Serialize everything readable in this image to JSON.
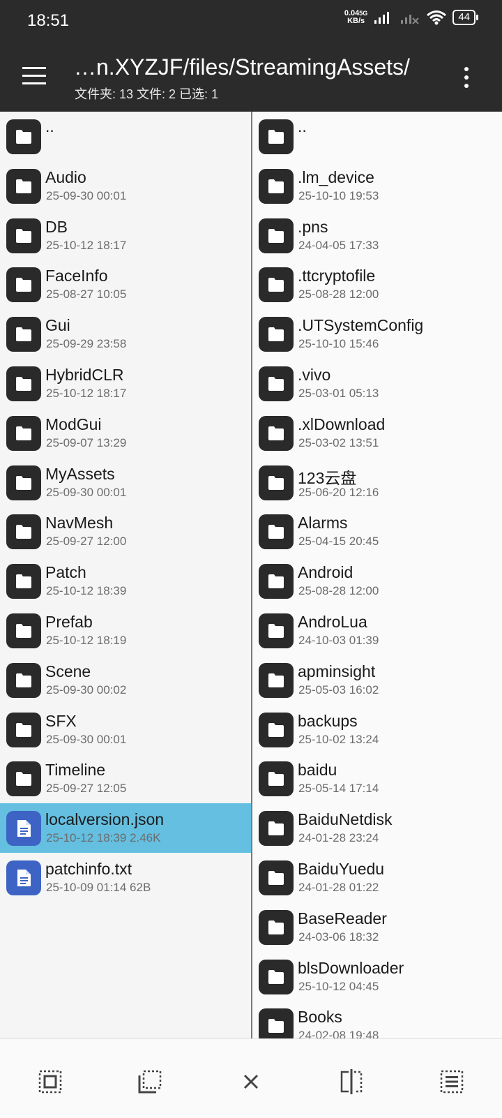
{
  "status": {
    "time": "18:51",
    "speed_value": "0.04",
    "speed_unit": "KB/s",
    "network": "5G",
    "battery": "44"
  },
  "header": {
    "path": "…n.XYZJF/files/StreamingAssets/",
    "counts": "文件夹: 13   文件: 2   已选: 1"
  },
  "left_pane": {
    "items": [
      {
        "name": "..",
        "meta": "",
        "type": "folder"
      },
      {
        "name": "Audio",
        "meta": "25-09-30 00:01",
        "type": "folder"
      },
      {
        "name": "DB",
        "meta": "25-10-12 18:17",
        "type": "folder"
      },
      {
        "name": "FaceInfo",
        "meta": "25-08-27 10:05",
        "type": "folder"
      },
      {
        "name": "Gui",
        "meta": "25-09-29 23:58",
        "type": "folder"
      },
      {
        "name": "HybridCLR",
        "meta": "25-10-12 18:17",
        "type": "folder"
      },
      {
        "name": "ModGui",
        "meta": "25-09-07 13:29",
        "type": "folder"
      },
      {
        "name": "MyAssets",
        "meta": "25-09-30 00:01",
        "type": "folder"
      },
      {
        "name": "NavMesh",
        "meta": "25-09-27 12:00",
        "type": "folder"
      },
      {
        "name": "Patch",
        "meta": "25-10-12 18:39",
        "type": "folder"
      },
      {
        "name": "Prefab",
        "meta": "25-10-12 18:19",
        "type": "folder"
      },
      {
        "name": "Scene",
        "meta": "25-09-30 00:02",
        "type": "folder"
      },
      {
        "name": "SFX",
        "meta": "25-09-30 00:01",
        "type": "folder"
      },
      {
        "name": "Timeline",
        "meta": "25-09-27 12:05",
        "type": "folder"
      },
      {
        "name": "localversion.json",
        "meta": "25-10-12 18:39  2.46K",
        "type": "file",
        "selected": true
      },
      {
        "name": "patchinfo.txt",
        "meta": "25-10-09 01:14  62B",
        "type": "file"
      }
    ]
  },
  "right_pane": {
    "items": [
      {
        "name": "..",
        "meta": ""
      },
      {
        "name": ".lm_device",
        "meta": "25-10-10 19:53"
      },
      {
        "name": ".pns",
        "meta": "24-04-05 17:33"
      },
      {
        "name": ".ttcryptofile",
        "meta": "25-08-28 12:00"
      },
      {
        "name": ".UTSystemConfig",
        "meta": "25-10-10 15:46"
      },
      {
        "name": ".vivo",
        "meta": "25-03-01 05:13"
      },
      {
        "name": ".xlDownload",
        "meta": "25-03-02 13:51"
      },
      {
        "name": "123云盘",
        "meta": "25-06-20 12:16"
      },
      {
        "name": "Alarms",
        "meta": "25-04-15 20:45"
      },
      {
        "name": "Android",
        "meta": "25-08-28 12:00"
      },
      {
        "name": "AndroLua",
        "meta": "24-10-03 01:39"
      },
      {
        "name": "apminsight",
        "meta": "25-05-03 16:02"
      },
      {
        "name": "backups",
        "meta": "25-10-02 13:24"
      },
      {
        "name": "baidu",
        "meta": "25-05-14 17:14"
      },
      {
        "name": "BaiduNetdisk",
        "meta": "24-01-28 23:24"
      },
      {
        "name": "BaiduYuedu",
        "meta": "24-01-28 01:22"
      },
      {
        "name": "BaseReader",
        "meta": "24-03-06 18:32"
      },
      {
        "name": "blsDownloader",
        "meta": "25-10-12 04:45"
      },
      {
        "name": "Books",
        "meta": "24-02-08 19:48"
      }
    ]
  },
  "bottom_bar": {
    "icons": [
      "select-all-icon",
      "select-range-icon",
      "close-icon",
      "split-view-icon",
      "list-view-icon"
    ]
  }
}
